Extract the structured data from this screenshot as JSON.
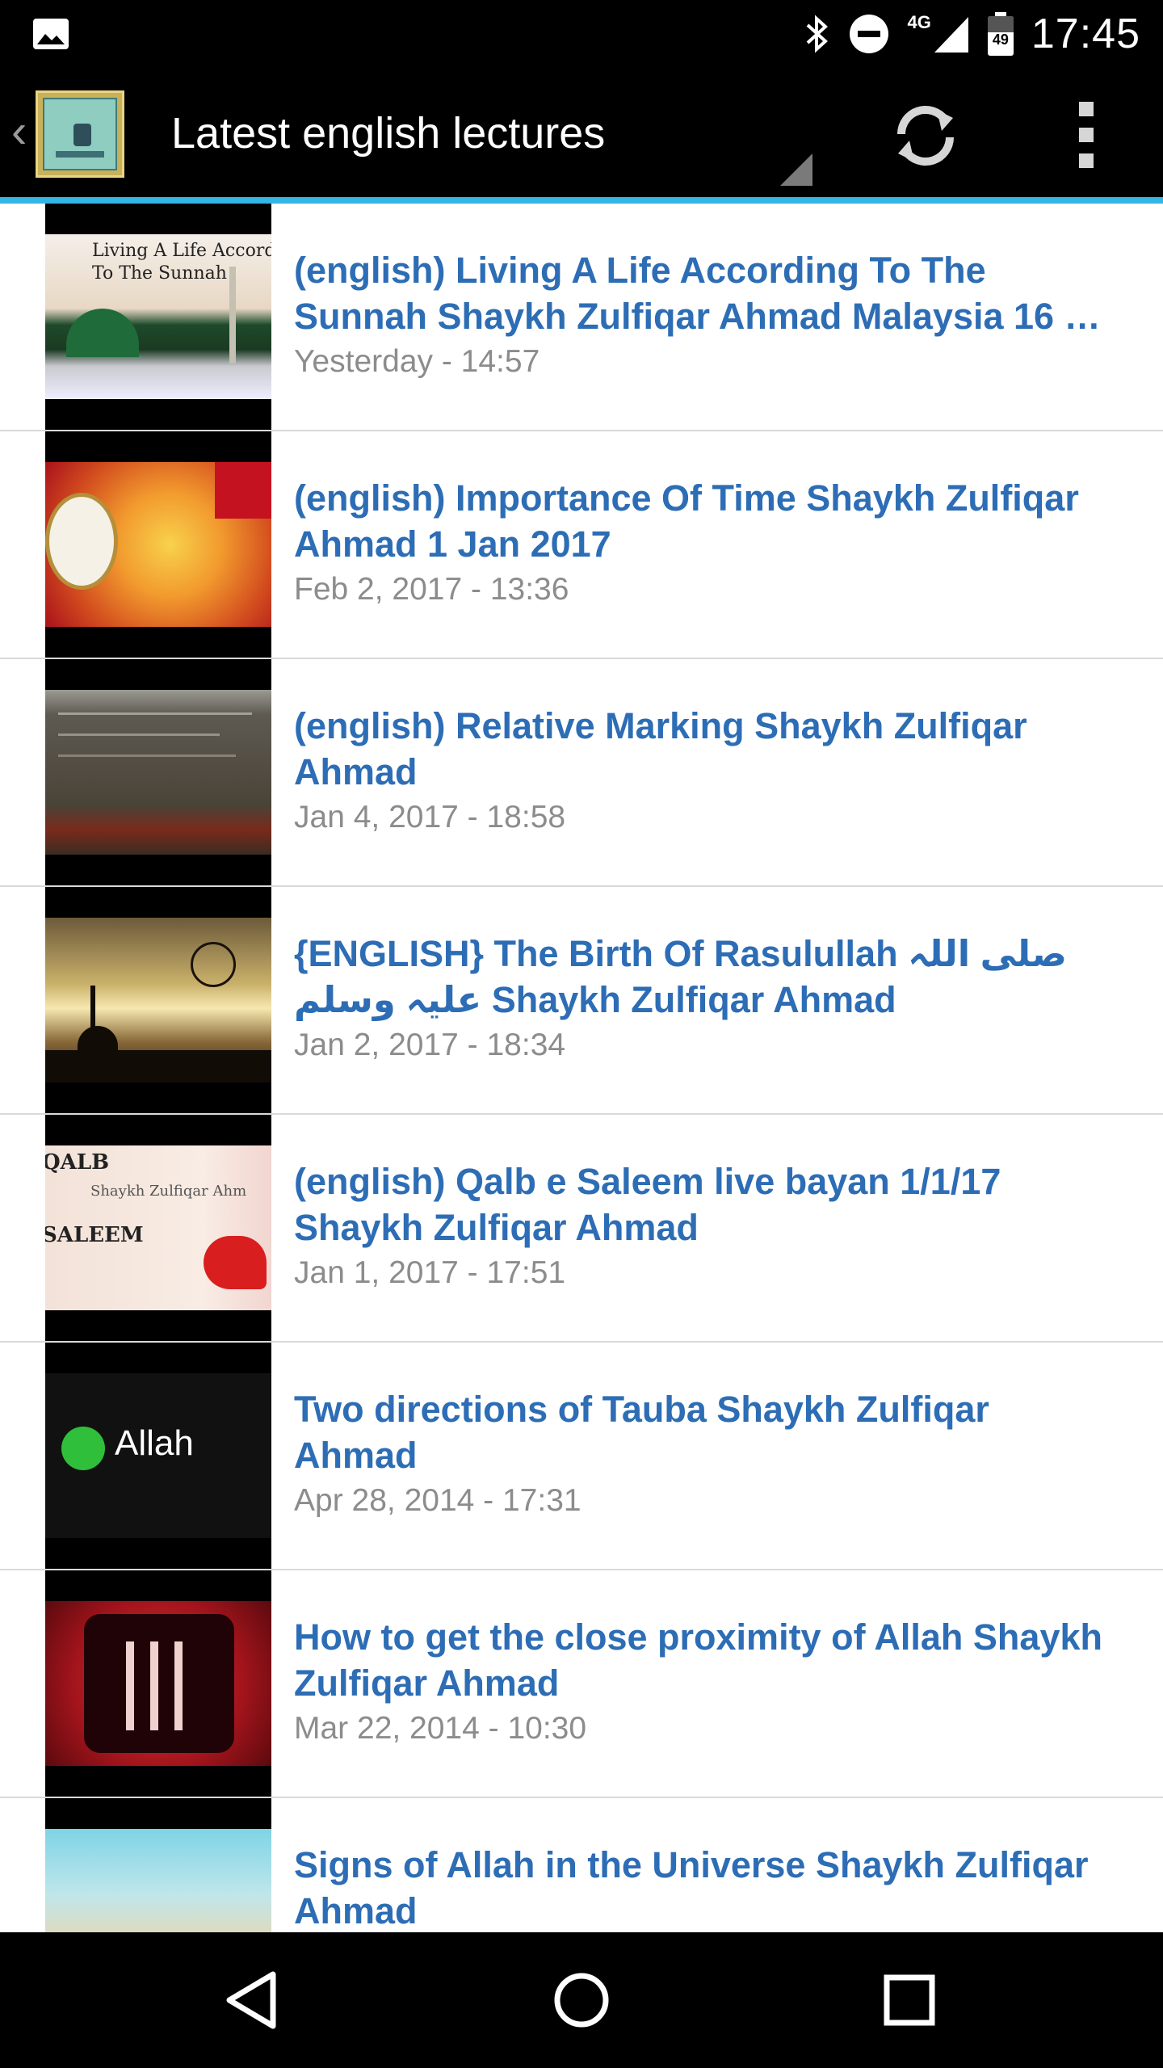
{
  "status_bar": {
    "time": "17:45",
    "network": "4G",
    "battery": "49",
    "icons": [
      "image-notification-icon",
      "bluetooth-icon",
      "do-not-disturb-icon",
      "signal-icon",
      "battery-icon"
    ]
  },
  "action_bar": {
    "title": "Latest english lectures",
    "icons": [
      "up-chevron-icon",
      "app-logo-icon",
      "spinner-indicator",
      "refresh-icon",
      "overflow-menu-icon"
    ]
  },
  "colors": {
    "accent": "#33b5e5",
    "title_blue": "#2d6db5",
    "date_gray": "#8c8c8c"
  },
  "items": [
    {
      "title": "(english) Living A Life According To The Sunnah Shaykh Zulfiqar Ahmad Malaysia 16 …",
      "date": "Yesterday - 14:57",
      "thumb_text": [
        "Living A Life Accordin",
        "To The Sunnah"
      ]
    },
    {
      "title": "(english) Importance Of Time Shaykh Zulfiqar Ahmad 1 Jan 2017",
      "date": "Feb 2, 2017 - 13:36"
    },
    {
      "title": "(english) Relative Marking Shaykh Zulfiqar Ahmad",
      "date": "Jan 4, 2017 - 18:58"
    },
    {
      "title": "{ENGLISH} The Birth Of Rasulullah صلی اللہ علیہ وسلم Shaykh Zulfiqar Ahmad",
      "date": "Jan 2, 2017 - 18:34"
    },
    {
      "title": "(english) Qalb e Saleem live bayan 1/1/17 Shaykh Zulfiqar Ahmad",
      "date": "Jan 1, 2017 - 17:51",
      "thumb_text": [
        "QALB",
        "Shaykh Zulfiqar Ahm",
        "SALEEM"
      ]
    },
    {
      "title": "Two directions of Tauba Shaykh Zulfiqar Ahmad",
      "date": "Apr 28, 2014 - 17:31",
      "thumb_text": [
        "Allah"
      ]
    },
    {
      "title": "How to get the close proximity of Allah Shaykh Zulfiqar Ahmad",
      "date": "Mar 22, 2014 - 10:30"
    },
    {
      "title": "Signs of Allah in the Universe Shaykh Zulfiqar Ahmad",
      "date": ""
    }
  ],
  "nav_bar": {
    "icons": [
      "back-icon",
      "home-icon",
      "recents-icon"
    ]
  }
}
